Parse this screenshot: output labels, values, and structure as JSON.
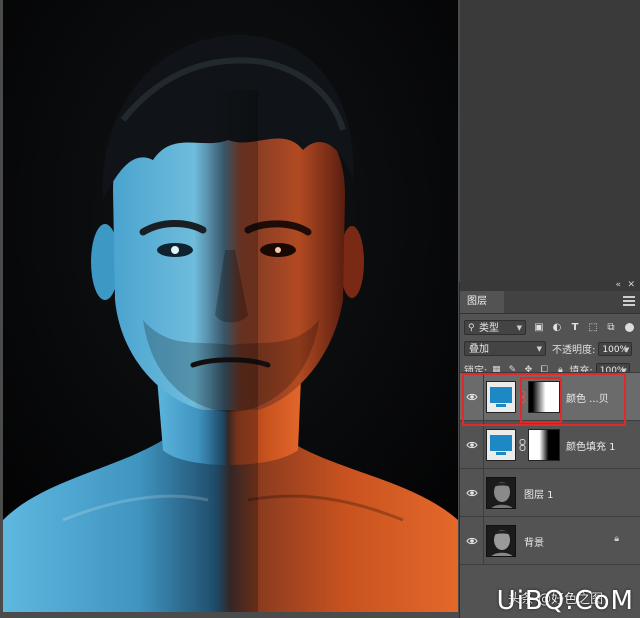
{
  "layers_panel": {
    "tab_label": "图层",
    "filter_type_label": "类型",
    "blend_mode": "叠加",
    "opacity_label": "不透明度:",
    "opacity_value": "100%",
    "lock_label": "锁定:",
    "fill_label": "填充:",
    "fill_value": "100%",
    "layers": [
      {
        "name": "颜色 ...贝",
        "type": "color-fill",
        "fill_color": "#1e88c4",
        "selected": true,
        "has_mask": true
      },
      {
        "name": "颜色填充 1",
        "type": "color-fill",
        "fill_color": "#1e88c4",
        "selected": false,
        "has_mask": true
      },
      {
        "name": "图层 1",
        "type": "pixel",
        "selected": false
      },
      {
        "name": "背景",
        "type": "background",
        "locked": true,
        "selected": false
      }
    ]
  },
  "watermark": {
    "main": "UiBQ.CoM",
    "sub": "头条 @好色之图"
  },
  "colors": {
    "panel_bg": "#535353",
    "highlight": "#e02a2a",
    "fill_swatch": "#1e88c4",
    "left_light": "#2f9ad0",
    "right_light": "#d9541c"
  }
}
